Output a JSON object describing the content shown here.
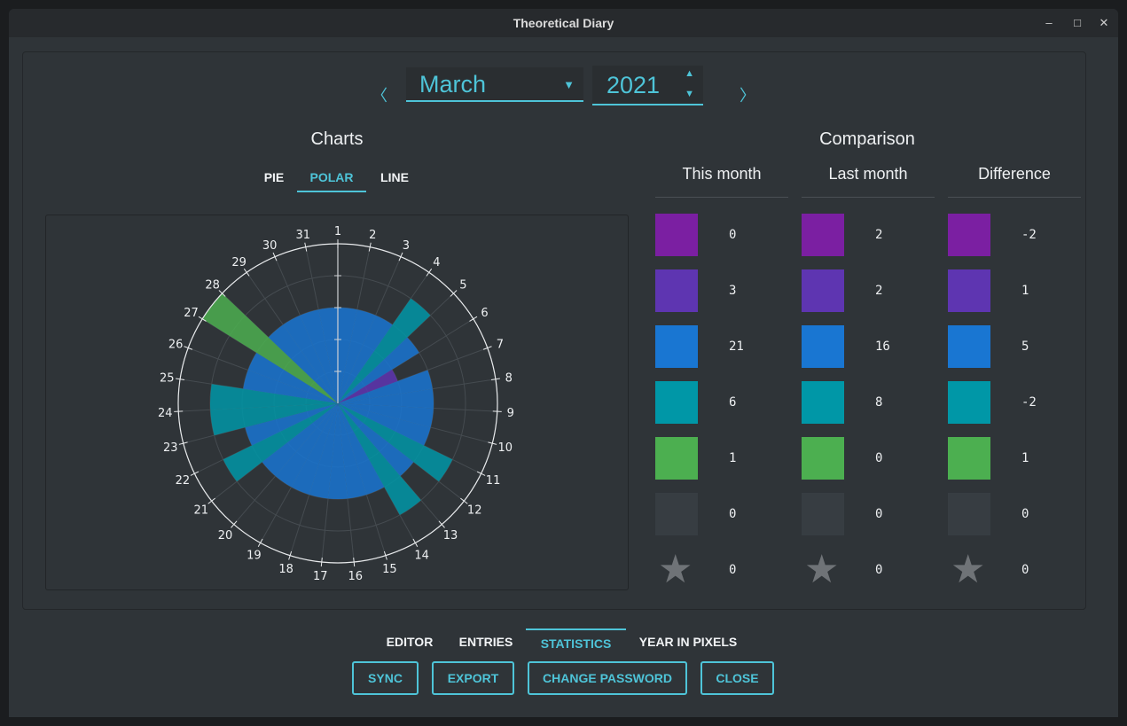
{
  "window": {
    "title": "Theoretical Diary",
    "minimize": "–",
    "maximize": "□",
    "close": "✕"
  },
  "date_nav": {
    "prev": "〈",
    "next": "〉",
    "month": "March",
    "year": "2021",
    "caret": "▼",
    "up": "▲",
    "down": "▼"
  },
  "charts": {
    "heading": "Charts",
    "tabs": [
      "PIE",
      "POLAR",
      "LINE"
    ],
    "active_tab": "POLAR"
  },
  "comparison": {
    "heading": "Comparison",
    "columns": [
      "This month",
      "Last month",
      "Difference"
    ],
    "colors": [
      "#7b1fa2",
      "#5e35b1",
      "#1976d2",
      "#0097a7",
      "#4caf50",
      "#373d42",
      "#6f7377"
    ],
    "rows": [
      [
        "0",
        "2",
        "-2"
      ],
      [
        "3",
        "2",
        "1"
      ],
      [
        "21",
        "16",
        "5"
      ],
      [
        "6",
        "8",
        "-2"
      ],
      [
        "1",
        "0",
        "1"
      ],
      [
        "0",
        "0",
        "0"
      ],
      [
        "0",
        "0",
        "0"
      ]
    ],
    "star_glyph": "★"
  },
  "chart_data": {
    "type": "polar",
    "categories": [
      "1",
      "2",
      "3",
      "4",
      "5",
      "6",
      "7",
      "8",
      "9",
      "10",
      "11",
      "12",
      "13",
      "14",
      "15",
      "16",
      "17",
      "18",
      "19",
      "20",
      "21",
      "22",
      "23",
      "24",
      "25",
      "26",
      "27",
      "28",
      "29",
      "30",
      "31"
    ],
    "rating_levels": [
      {
        "level": 1,
        "color": "#7b1fa2"
      },
      {
        "level": 2,
        "color": "#5e35b1"
      },
      {
        "level": 3,
        "color": "#1976d2"
      },
      {
        "level": 4,
        "color": "#0097a7"
      },
      {
        "level": 5,
        "color": "#4caf50"
      }
    ],
    "values": [
      3,
      3,
      3,
      4,
      3,
      2,
      3,
      3,
      3,
      3,
      4,
      3,
      4,
      3,
      3,
      3,
      3,
      3,
      3,
      3,
      4,
      3,
      4,
      4,
      3,
      3,
      5,
      3,
      3,
      3,
      3
    ],
    "rmax": 5
  },
  "bottom_tabs": [
    "EDITOR",
    "ENTRIES",
    "STATISTICS",
    "YEAR IN PIXELS"
  ],
  "bottom_active": "STATISTICS",
  "buttons": {
    "sync": "SYNC",
    "export": "EXPORT",
    "change_password": "CHANGE PASSWORD",
    "close": "CLOSE"
  }
}
